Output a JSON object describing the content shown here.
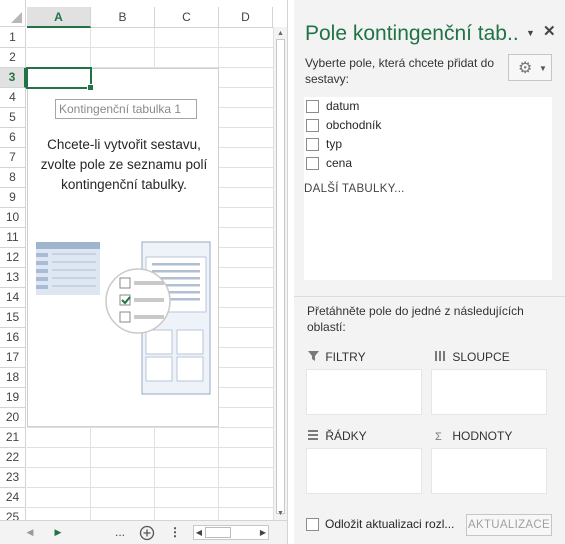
{
  "spreadsheet": {
    "columns": [
      {
        "label": "A",
        "selected": true
      },
      {
        "label": "B",
        "selected": false
      },
      {
        "label": "C",
        "selected": false
      },
      {
        "label": "D",
        "selected": false
      }
    ],
    "rows": [
      "1",
      "2",
      "3",
      "4",
      "5",
      "6",
      "7",
      "8",
      "9",
      "10",
      "11",
      "12",
      "13",
      "14",
      "15",
      "16",
      "17",
      "18",
      "19",
      "20",
      "21",
      "22",
      "23",
      "24",
      "25"
    ],
    "selected_row": "3",
    "accent_color": "#217346"
  },
  "pivot_placeholder": {
    "name": "Kontingenční tabulka 1",
    "instruction_lines": [
      "Chcete-li vytvořit sestavu,",
      "zvolte pole ze seznamu polí",
      "kontingenční tabulky."
    ]
  },
  "sheet_bar": {
    "prev_icon": "left-triangle-icon",
    "next_icon": "right-triangle-icon",
    "more": "...",
    "add_icon": "add-sheet-icon",
    "options": "⋮"
  },
  "task_pane": {
    "title": "Pole kontingenční tab...",
    "subtitle": "Vyberte pole, která chcete přidat do sestavy:",
    "gear_icon": "gear-icon",
    "fields": [
      "datum",
      "obchodník",
      "typ",
      "cena"
    ],
    "more_tables": "DALŠÍ TABULKY...",
    "drag_hint": "Přetáhněte pole do jedné z následujících oblastí:",
    "areas": {
      "filters": "FILTRY",
      "columns": "SLOUPCE",
      "rows": "ŘÁDKY",
      "values": "HODNOTY"
    },
    "defer_label": "Odložit aktualizaci rozl...",
    "update_button": "AKTUALIZACE"
  }
}
